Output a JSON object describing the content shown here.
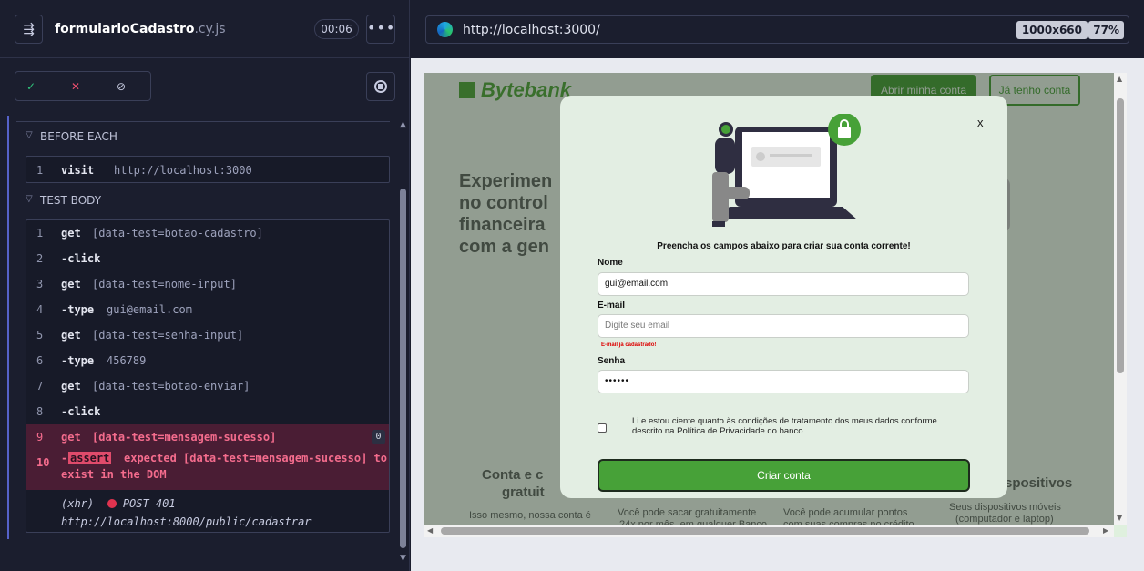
{
  "left": {
    "spec_name": "formularioCadastro",
    "spec_ext": ".cy.js",
    "timer": "00:06",
    "stats": {
      "passed": "--",
      "failed": "--",
      "pending": "--"
    },
    "before_each_label": "BEFORE EACH",
    "test_body_label": "TEST BODY",
    "before_each": [
      {
        "num": "1",
        "name": "visit",
        "msg": "http://localhost:3000"
      }
    ],
    "commands": [
      {
        "num": "1",
        "name": "get",
        "msg": "[data-test=botao-cadastro]"
      },
      {
        "num": "2",
        "name": "-click",
        "msg": ""
      },
      {
        "num": "3",
        "name": "get",
        "msg": "[data-test=nome-input]"
      },
      {
        "num": "4",
        "name": "-type",
        "msg": "gui@email.com"
      },
      {
        "num": "5",
        "name": "get",
        "msg": "[data-test=senha-input]"
      },
      {
        "num": "6",
        "name": "-type",
        "msg": "456789"
      },
      {
        "num": "7",
        "name": "get",
        "msg": "[data-test=botao-enviar]"
      },
      {
        "num": "8",
        "name": "-click",
        "msg": ""
      },
      {
        "num": "9",
        "name": "get",
        "msg": "[data-test=mensagem-sucesso]"
      }
    ],
    "hit_count": "0",
    "error": {
      "num": "10",
      "dash": "-",
      "badge": "assert",
      "line1": "expected [data-test=mensagem-sucesso] to",
      "line2": "exist in the DOM"
    },
    "xhr": {
      "prefix": "(xhr)",
      "method": "POST 401",
      "url": "http://localhost:8000/public/cadastrar"
    }
  },
  "right": {
    "url": "http://localhost:3000/",
    "viewport": "1000x660",
    "zoom": "77%",
    "background_app": {
      "logo": "Bytebank",
      "open_account": "Abrir minha conta",
      "have_account": "Já tenho conta",
      "hero": [
        "Experimen",
        "no control",
        "financeira",
        "com a gen"
      ],
      "card1_title": "Conta e c",
      "card1_title2": "gratuit",
      "card1_text": "Isso mesmo, nossa conta é",
      "card2_text": "Você pode sacar gratuitamente",
      "card2_text2": "24x por mês, em qualquer Banco",
      "card3_text": "Você pode acumular pontos",
      "card3_text2": "com suas compras no crédito",
      "card4_title": "Dispositivos",
      "card4_text": "Seus dispositivos móveis",
      "card4_text2": "(computador e laptop)"
    },
    "modal": {
      "close": "x",
      "heading": "Preencha os campos abaixo para criar sua conta corrente!",
      "name_label": "Nome",
      "name_value": "gui@email.com",
      "email_label": "E-mail",
      "email_placeholder": "Digite seu email",
      "email_error": "E-mail já cadastrado!",
      "password_label": "Senha",
      "password_value": "••••••",
      "terms": "Li e estou ciente quanto às condições de tratamento dos meus dados conforme descrito na Política de Privacidade do banco.",
      "submit": "Criar conta"
    }
  }
}
